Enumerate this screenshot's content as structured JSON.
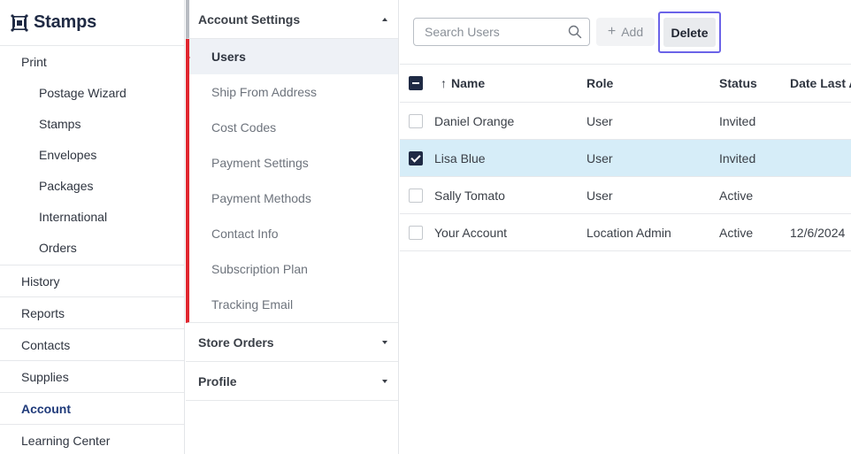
{
  "brand": {
    "name": "Stamps",
    "color": "#1f2a44"
  },
  "leftnav": {
    "print": "Print",
    "print_items": [
      "Postage Wizard",
      "Stamps",
      "Envelopes",
      "Packages",
      "International",
      "Orders"
    ],
    "items": [
      "History",
      "Reports",
      "Contacts",
      "Supplies",
      "Account",
      "Learning Center"
    ],
    "active": "Account"
  },
  "settings": {
    "account_settings": "Account Settings",
    "items": [
      "Users",
      "Ship From Address",
      "Cost Codes",
      "Payment Settings",
      "Payment Methods",
      "Contact Info",
      "Subscription Plan",
      "Tracking Email"
    ],
    "selected": "Users",
    "store_orders": "Store Orders",
    "profile": "Profile",
    "accent_color": "#e0262f"
  },
  "toolbar": {
    "search_placeholder": "Search Users",
    "search_icon": "search-icon",
    "add_label": "Add",
    "delete_label": "Delete",
    "focus_color": "#6b63e8"
  },
  "table": {
    "columns": {
      "name": "Name",
      "role": "Role",
      "status": "Status",
      "date": "Date Last A"
    },
    "sort_indicator": "↑",
    "rows": [
      {
        "name": "Daniel Orange",
        "role": "User",
        "status": "Invited",
        "date": "",
        "checked": false
      },
      {
        "name": "Lisa Blue",
        "role": "User",
        "status": "Invited",
        "date": "",
        "checked": true
      },
      {
        "name": "Sally Tomato",
        "role": "User",
        "status": "Active",
        "date": "",
        "checked": false
      },
      {
        "name": "Your Account",
        "role": "Location Admin",
        "status": "Active",
        "date": "12/6/2024",
        "checked": false
      }
    ],
    "selected_row_color": "#d6edf8"
  }
}
